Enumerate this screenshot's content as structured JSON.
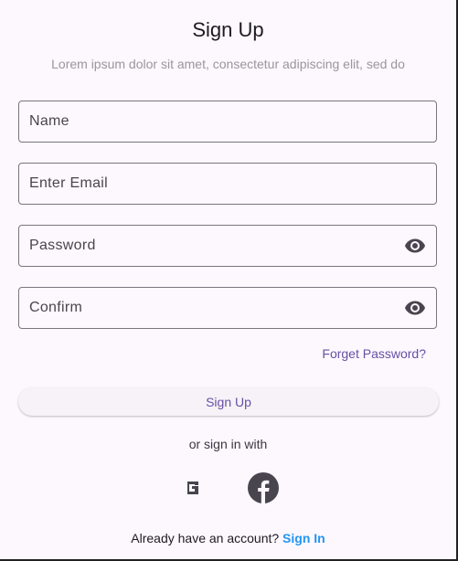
{
  "header": {
    "title": "Sign Up",
    "subtitle": "Lorem ipsum dolor sit amet, consectetur adipiscing elit, sed do"
  },
  "fields": [
    {
      "label": "Name",
      "icon": null
    },
    {
      "label": "Enter Email",
      "icon": null
    },
    {
      "label": "Password",
      "icon": "eye-icon"
    },
    {
      "label": "Confirm",
      "icon": "eye-icon"
    }
  ],
  "forgot_label": "Forget Password?",
  "signup_button": "Sign Up",
  "or_text": "or sign in with",
  "social": [
    "google-icon",
    "facebook-icon"
  ],
  "footer": {
    "text": "Already have an account?",
    "link": "Sign In"
  },
  "colors": {
    "accent": "#6750a4",
    "link": "#2196f3",
    "background": "#fdf7fe"
  }
}
